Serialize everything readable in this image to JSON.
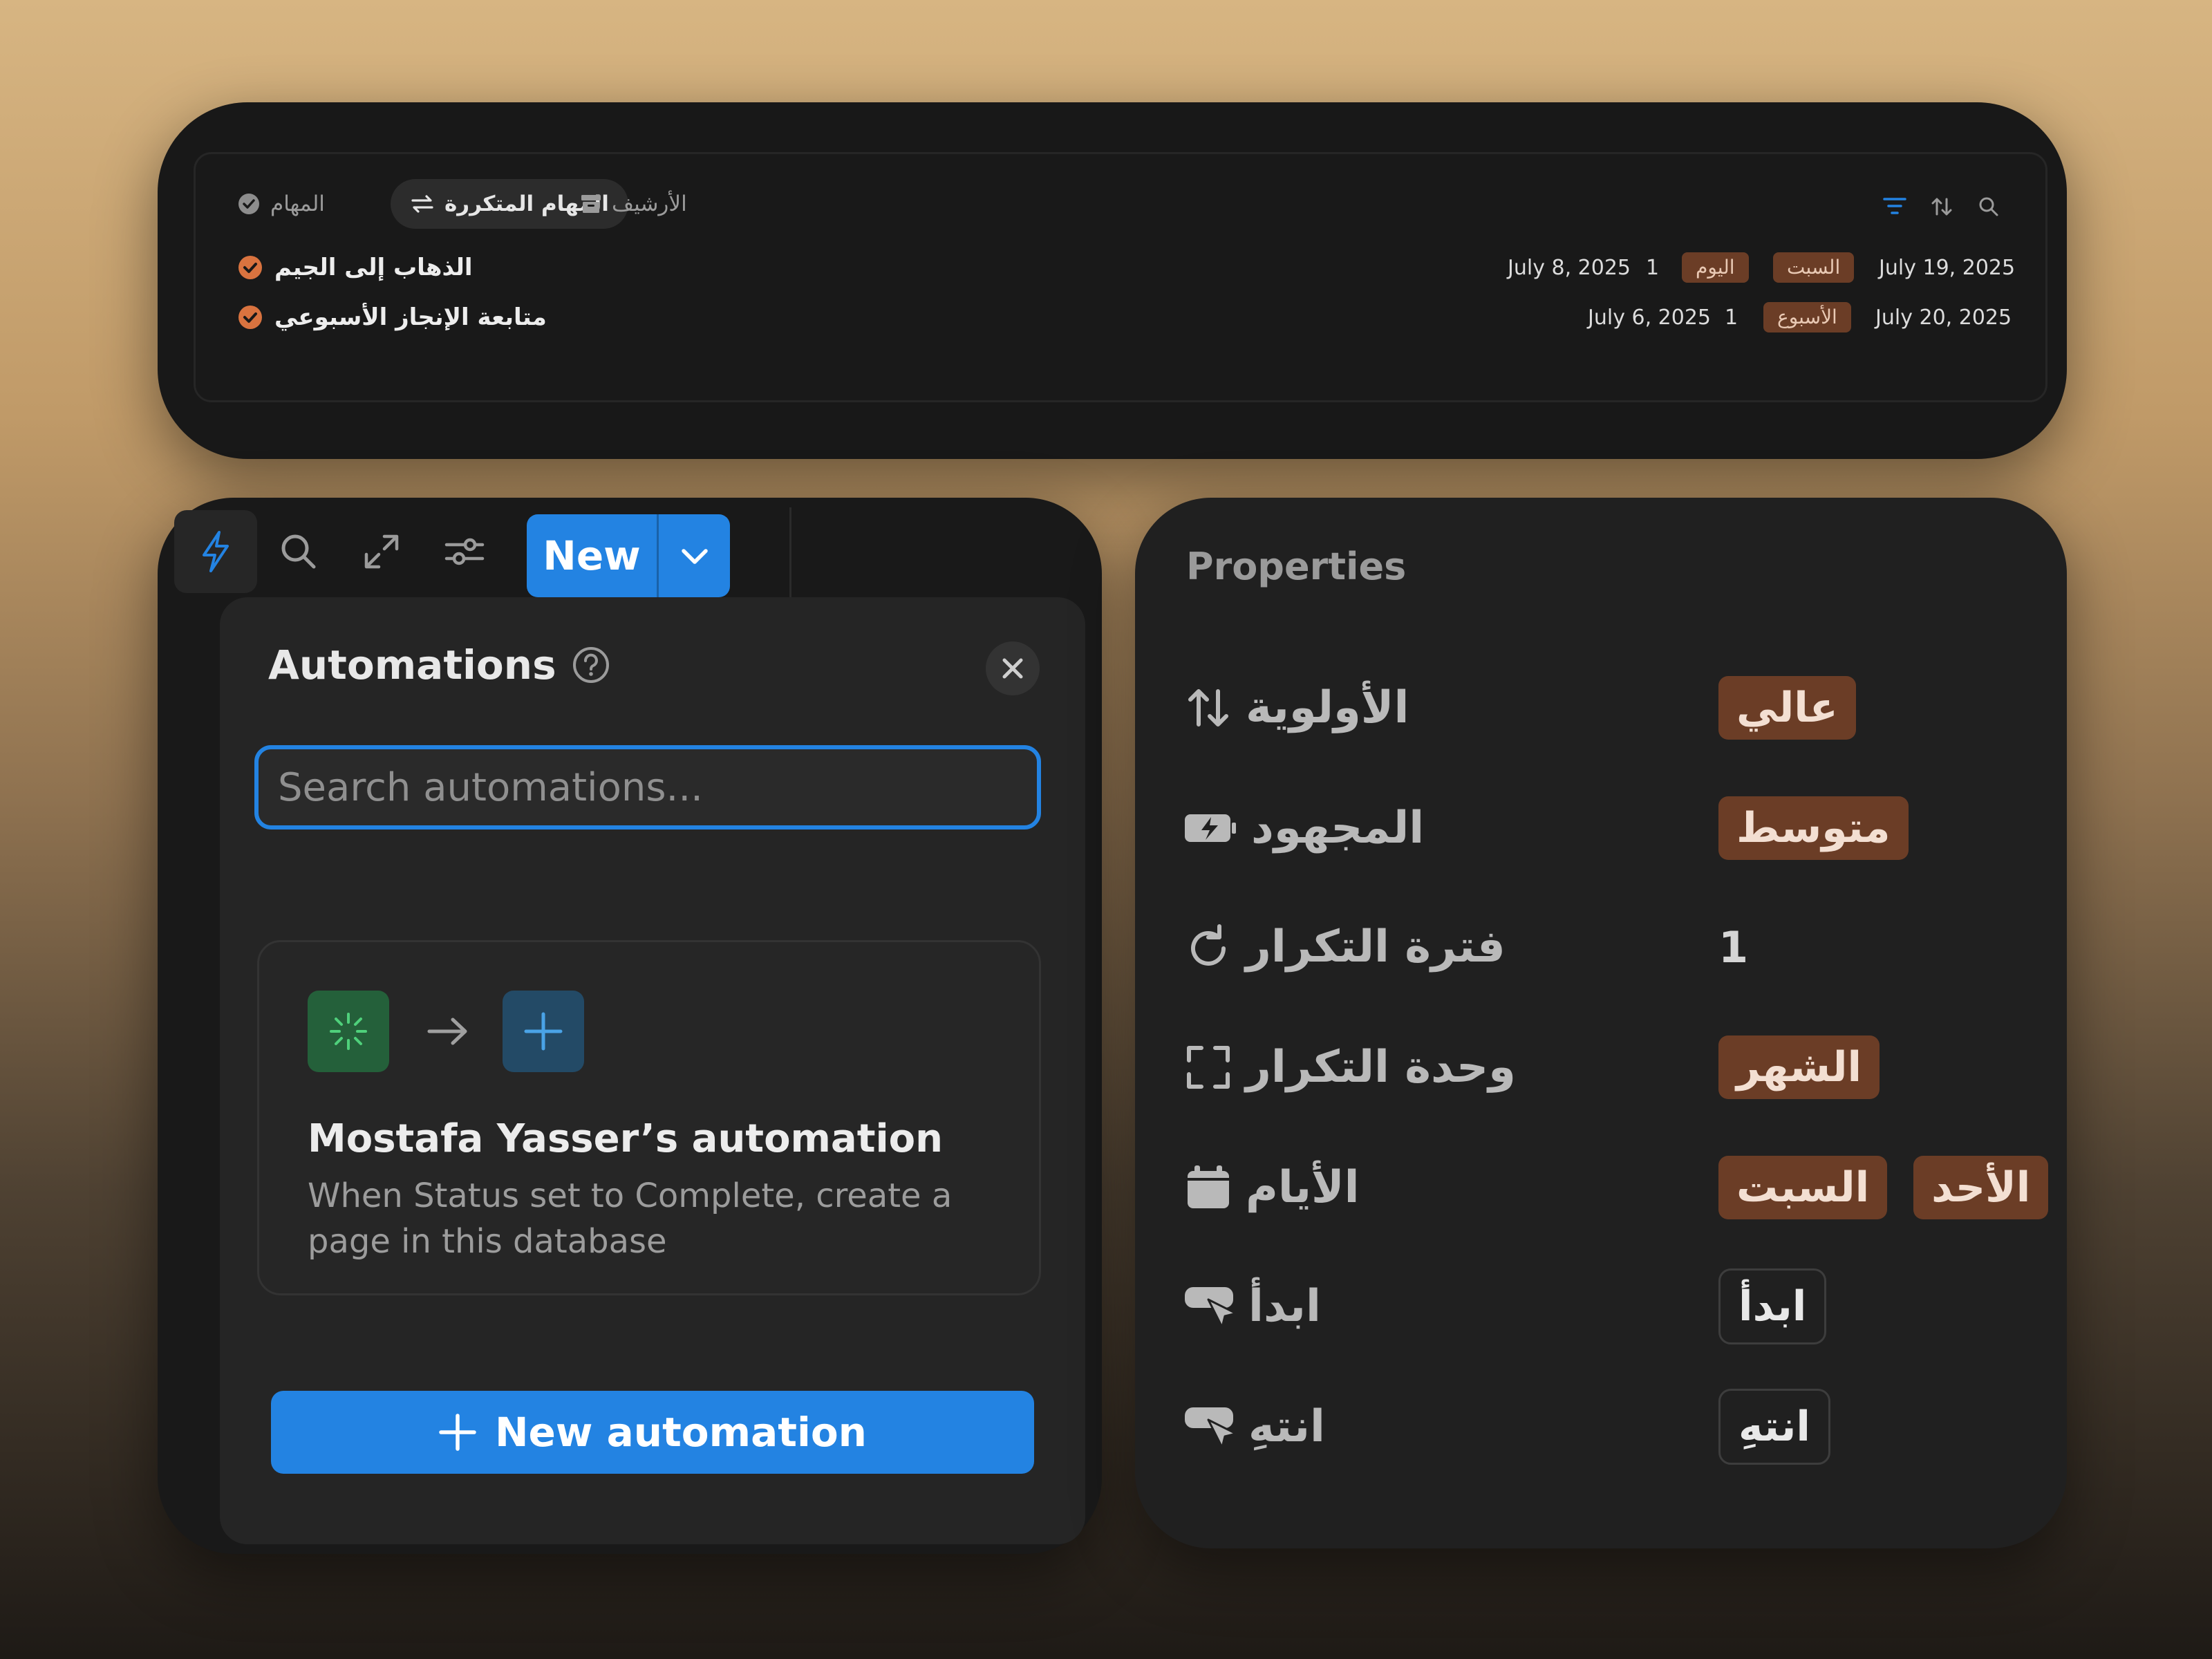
{
  "database": {
    "tabs": [
      {
        "label": "المهام",
        "icon": "check-circle-icon",
        "active": false
      },
      {
        "label": "المهام المتكررة",
        "icon": "repeat-icon",
        "active": true
      },
      {
        "label": "الأرشيف",
        "icon": "archive-icon",
        "active": false
      }
    ],
    "toolbar_icons": [
      "filter-icon",
      "sort-icon",
      "search-icon"
    ],
    "rows": [
      {
        "title": "الذهاب إلى الجيم",
        "date_start": "July 8, 2025",
        "interval": "1",
        "unit": "اليوم",
        "day": "السبت",
        "date_next": "July 19, 2025"
      },
      {
        "title": "متابعة الإنجاز الأسبوعي",
        "date_start": "July 6, 2025",
        "interval": "1",
        "unit": "الأسبوع",
        "day": "",
        "date_next": "July 20, 2025"
      }
    ]
  },
  "topbar": {
    "icons": [
      "lightning-icon",
      "search-icon",
      "expand-icon",
      "sliders-icon"
    ],
    "new_label": "New"
  },
  "automations": {
    "title": "Automations",
    "search_placeholder": "Search automations...",
    "card": {
      "name": "Mostafa Yasser’s automation",
      "description": "When Status set to Complete, create a page in this database"
    },
    "new_button_label": "New automation"
  },
  "properties": {
    "heading": "Properties",
    "rows": [
      {
        "label": "الأولوية",
        "icon": "sort-arrows-icon",
        "values": [
          "عالي"
        ],
        "kind": "tag"
      },
      {
        "label": "المجهود",
        "icon": "battery-bolt-icon",
        "values": [
          "متوسط"
        ],
        "kind": "tag"
      },
      {
        "label": "فترة التكرار",
        "icon": "refresh-icon",
        "values": [
          "1"
        ],
        "kind": "number"
      },
      {
        "label": "وحدة التكرار",
        "icon": "frame-corners-icon",
        "values": [
          "الشهر"
        ],
        "kind": "tag"
      },
      {
        "label": "الأيام",
        "icon": "calendar-icon",
        "values": [
          "السبت",
          "الأحد"
        ],
        "kind": "tag"
      },
      {
        "label": "ابدأ",
        "icon": "click-button-icon",
        "values": [
          "ابدأ"
        ],
        "kind": "button"
      },
      {
        "label": "انتهِ",
        "icon": "click-button-icon",
        "values": [
          "انتهِ"
        ],
        "kind": "button"
      }
    ]
  },
  "colors": {
    "accent_blue": "#2383e2",
    "tag_brown": "#6b3d26",
    "check_orange": "#d9733f"
  }
}
